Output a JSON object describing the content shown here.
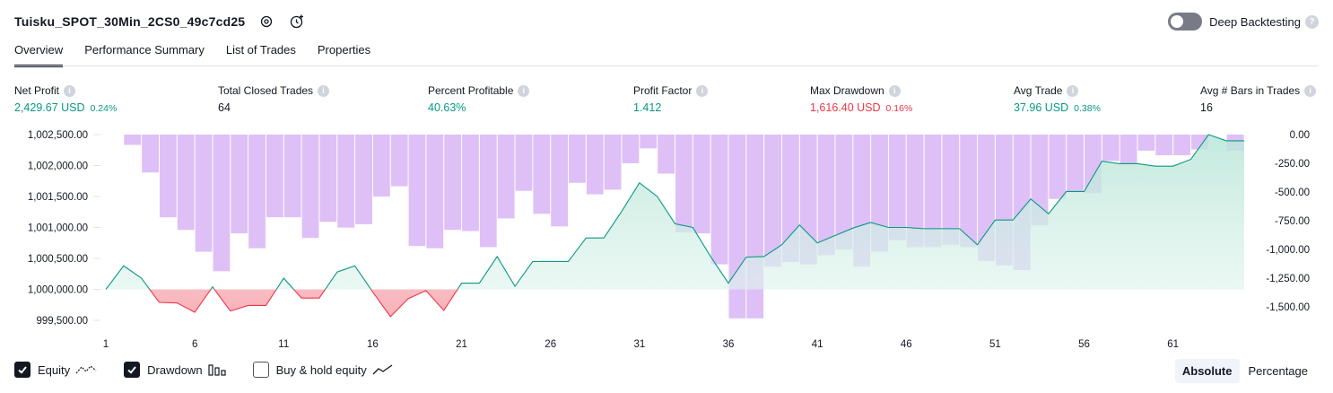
{
  "header": {
    "strategy_title": "Tuisku_SPOT_30Min_2CS0_49c7cd25",
    "settings_icon": "gear-icon",
    "alert_icon": "add-alert-icon"
  },
  "deep_backtesting": {
    "label": "Deep Backtesting",
    "enabled": false,
    "help": "?"
  },
  "tabs": [
    {
      "label": "Overview",
      "active": true
    },
    {
      "label": "Performance Summary",
      "active": false
    },
    {
      "label": "List of Trades",
      "active": false
    },
    {
      "label": "Properties",
      "active": false
    }
  ],
  "stats": [
    {
      "label": "Net Profit",
      "value": "2,429.67 USD",
      "pct": "0.24%",
      "tone": "pos"
    },
    {
      "label": "Total Closed Trades",
      "value": "64",
      "pct": "",
      "tone": "neutral"
    },
    {
      "label": "Percent Profitable",
      "value": "40.63%",
      "pct": "",
      "tone": "pos"
    },
    {
      "label": "Profit Factor",
      "value": "1.412",
      "pct": "",
      "tone": "pos"
    },
    {
      "label": "Max Drawdown",
      "value": "1,616.40 USD",
      "pct": "0.16%",
      "tone": "neg"
    },
    {
      "label": "Avg Trade",
      "value": "37.96 USD",
      "pct": "0.38%",
      "tone": "pos"
    },
    {
      "label": "Avg # Bars in Trades",
      "value": "16",
      "pct": "",
      "tone": "neutral"
    }
  ],
  "chart_data": {
    "type": "line",
    "x_tick_labels": [
      "1",
      "6",
      "11",
      "16",
      "21",
      "26",
      "31",
      "36",
      "41",
      "46",
      "51",
      "56",
      "61"
    ],
    "left_axis": {
      "ticks": [
        "1,002,500.00",
        "1,002,000.00",
        "1,001,500.00",
        "1,001,000.00",
        "1,000,500.00",
        "1,000,000.00",
        "999,500.00"
      ],
      "ylim": [
        999400,
        1002500
      ],
      "baseline": 1000000
    },
    "right_axis": {
      "ticks": [
        "0.00",
        "-250.00",
        "-500.00",
        "-750.00",
        "-1,000.00",
        "-1,250.00",
        "-1,500.00"
      ],
      "ylim": [
        -1616.4,
        0
      ]
    },
    "series": [
      {
        "name": "Equity",
        "x": [
          1,
          2,
          3,
          4,
          5,
          6,
          7,
          8,
          9,
          10,
          11,
          12,
          13,
          14,
          15,
          16,
          17,
          18,
          19,
          20,
          21,
          22,
          23,
          24,
          25,
          26,
          27,
          28,
          29,
          30,
          31,
          32,
          33,
          34,
          35,
          36,
          37,
          38,
          39,
          40,
          41,
          42,
          43,
          44,
          45,
          46,
          47,
          48,
          49,
          50,
          51,
          52,
          53,
          54,
          55,
          56,
          57,
          58,
          59,
          60,
          61,
          62,
          63,
          64,
          65
        ],
        "values": [
          1000000,
          1000380,
          1000180,
          999790,
          999780,
          999630,
          1000040,
          999650,
          999740,
          999740,
          1000180,
          999860,
          999860,
          1000280,
          1000380,
          999960,
          999560,
          999850,
          999980,
          999660,
          1000100,
          1000100,
          1000530,
          1000050,
          1000450,
          1000450,
          1000450,
          1000830,
          1000830,
          1001260,
          1001720,
          1001500,
          1001060,
          1001000,
          1000530,
          1000100,
          1000520,
          1000530,
          1000720,
          1001040,
          1000750,
          1000870,
          1000990,
          1001080,
          1001000,
          1001000,
          1000980,
          1000980,
          1000980,
          1000720,
          1001120,
          1001120,
          1001460,
          1001220,
          1001580,
          1001580,
          1002070,
          1002030,
          1002030,
          1001990,
          1001990,
          1002100,
          1002500,
          1002400,
          1002400
        ],
        "color": "#089981"
      },
      {
        "name": "Drawdown",
        "type": "bar",
        "values": [
          0,
          -90,
          -330,
          -720,
          -830,
          -1020,
          -1190,
          -860,
          -990,
          -720,
          -720,
          -900,
          -760,
          -810,
          -780,
          -540,
          -450,
          -970,
          -990,
          -830,
          -840,
          -980,
          -730,
          -490,
          -690,
          -800,
          -420,
          -520,
          -480,
          -250,
          -120,
          -340,
          -850,
          -860,
          -1130,
          -1600,
          -1600,
          -1150,
          -1110,
          -1130,
          -1050,
          -1000,
          -1150,
          -1020,
          -920,
          -980,
          -980,
          -960,
          -980,
          -1100,
          -1140,
          -1180,
          -790,
          -560,
          -500,
          -510,
          -230,
          -250,
          -140,
          -180,
          -180,
          -130,
          0,
          -140
        ],
        "color": "#e1bee7"
      }
    ]
  },
  "legend": [
    {
      "label": "Equity",
      "checked": true,
      "icon": "equity-line-icon"
    },
    {
      "label": "Drawdown",
      "checked": true,
      "icon": "drawdown-bars-icon"
    },
    {
      "label": "Buy & hold equity",
      "checked": false,
      "icon": "buy-hold-line-icon"
    }
  ],
  "modes": [
    {
      "label": "Absolute",
      "active": true
    },
    {
      "label": "Percentage",
      "active": false
    }
  ],
  "colors": {
    "profit": "#089981",
    "loss": "#f23645",
    "drawdown_bar": "#dcbdf7",
    "equity_fill": "#d5f0e8",
    "loss_fill": "#f9d0d4"
  }
}
